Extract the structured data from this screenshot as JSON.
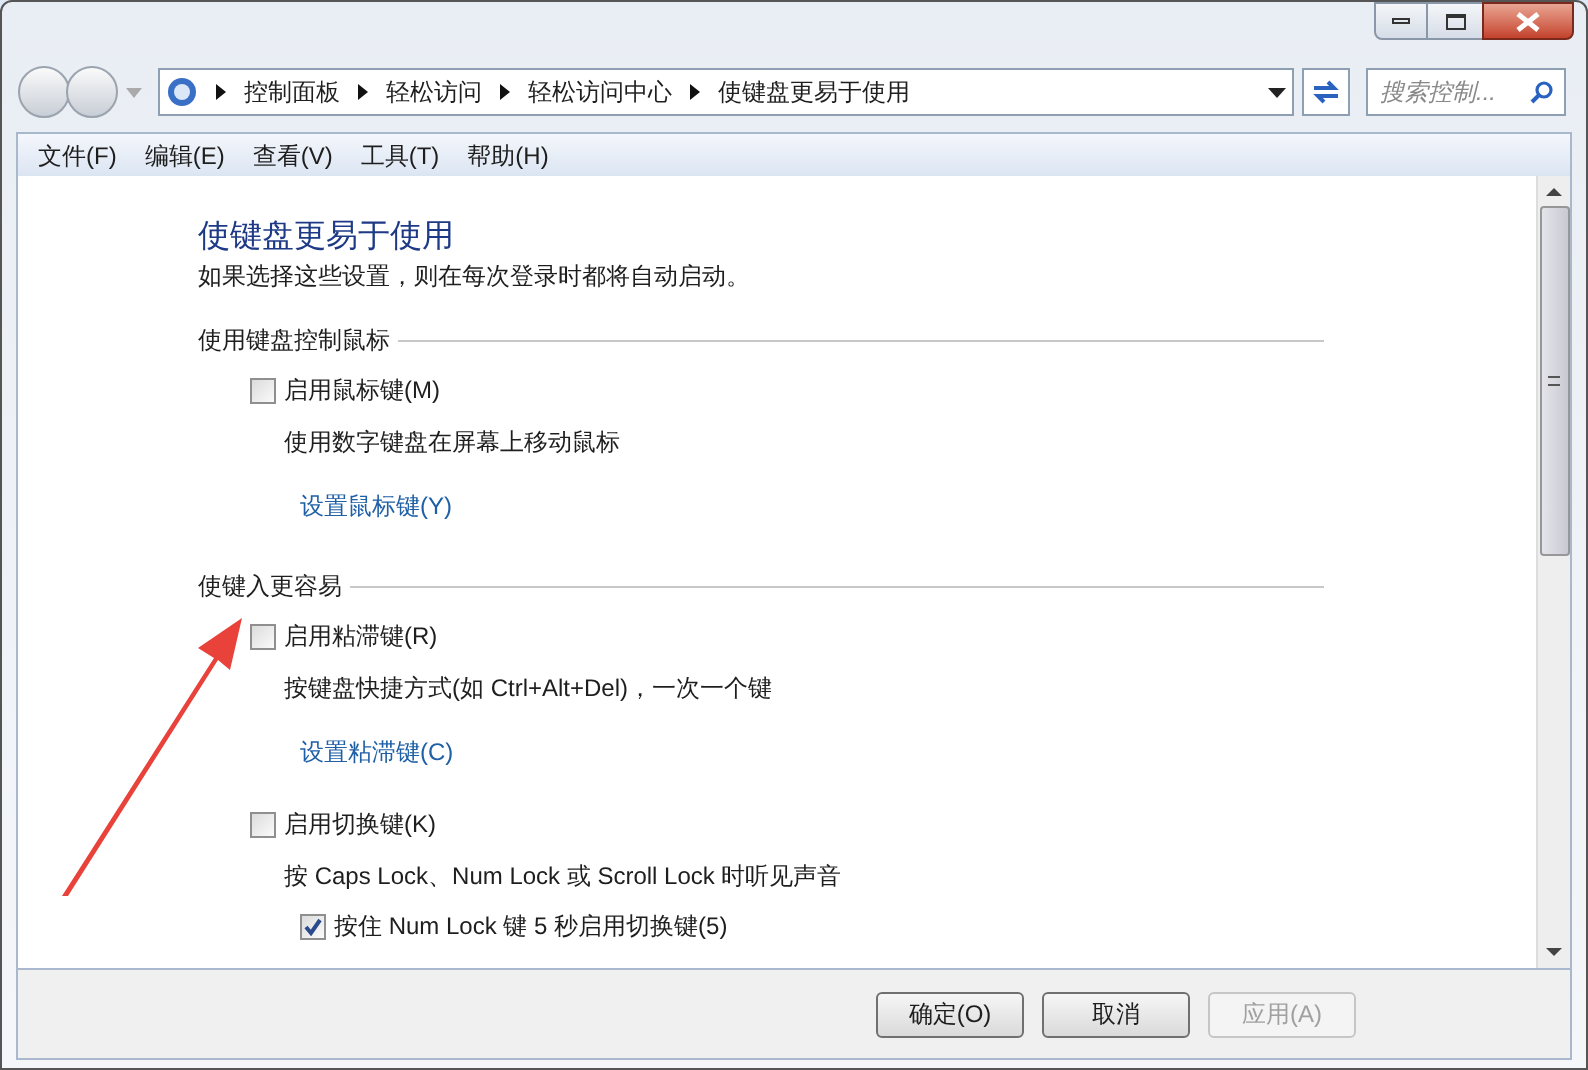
{
  "address_bar": {
    "crumbs": [
      "控制面板",
      "轻松访问",
      "轻松访问中心",
      "使键盘更易于使用"
    ]
  },
  "search": {
    "placeholder": "搜索控制..."
  },
  "menu": [
    "文件(F)",
    "编辑(E)",
    "查看(V)",
    "工具(T)",
    "帮助(H)"
  ],
  "page": {
    "title": "使键盘更易于使用",
    "subtitle": "如果选择这些设置，则在每次登录时都将自动启动。",
    "sections": [
      {
        "heading": "使用键盘控制鼠标",
        "items": [
          {
            "kind": "checkbox",
            "label": "启用鼠标键(M)",
            "checked": false
          },
          {
            "kind": "text",
            "label": "使用数字键盘在屏幕上移动鼠标"
          },
          {
            "kind": "link",
            "label": "设置鼠标键(Y)"
          }
        ]
      },
      {
        "heading": "使键入更容易",
        "items": [
          {
            "kind": "checkbox",
            "label": "启用粘滞键(R)",
            "checked": false
          },
          {
            "kind": "text",
            "label": "按键盘快捷方式(如 Ctrl+Alt+Del)，一次一个键"
          },
          {
            "kind": "link",
            "label": "设置粘滞键(C)"
          },
          {
            "kind": "checkbox",
            "label": "启用切换键(K)",
            "checked": false
          },
          {
            "kind": "text",
            "label": "按 Caps Lock、Num Lock 或 Scroll Lock 时听见声音"
          },
          {
            "kind": "subcheckbox",
            "label": "按住 Num Lock 键 5 秒启用切换键(5)",
            "checked": true
          }
        ]
      }
    ]
  },
  "buttons": [
    {
      "label": "确定(O)",
      "disabled": false
    },
    {
      "label": "取消",
      "disabled": false
    },
    {
      "label": "应用(A)",
      "disabled": true
    }
  ]
}
